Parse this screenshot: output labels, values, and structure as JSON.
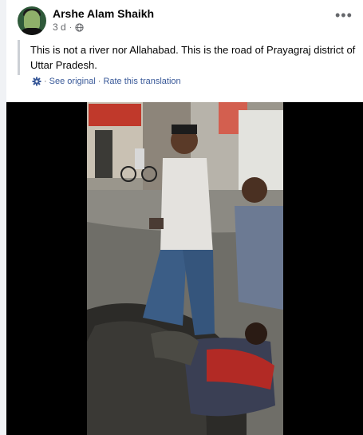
{
  "post": {
    "author": "Arshe Alam Shaikh",
    "time": "3 d",
    "more_label": "•••",
    "text": "This is not a river nor Allahabad. This is the road of Prayagraj district of Uttar Pradesh.",
    "translate_links": {
      "see_original": "See original",
      "rate_translation": "Rate this translation",
      "separator": "·"
    }
  },
  "icons": [
    "globe-icon",
    "gear-icon",
    "more-options-icon"
  ],
  "colors": {
    "link": "#385898",
    "meta": "#65676b",
    "background": "#f0f2f5"
  }
}
